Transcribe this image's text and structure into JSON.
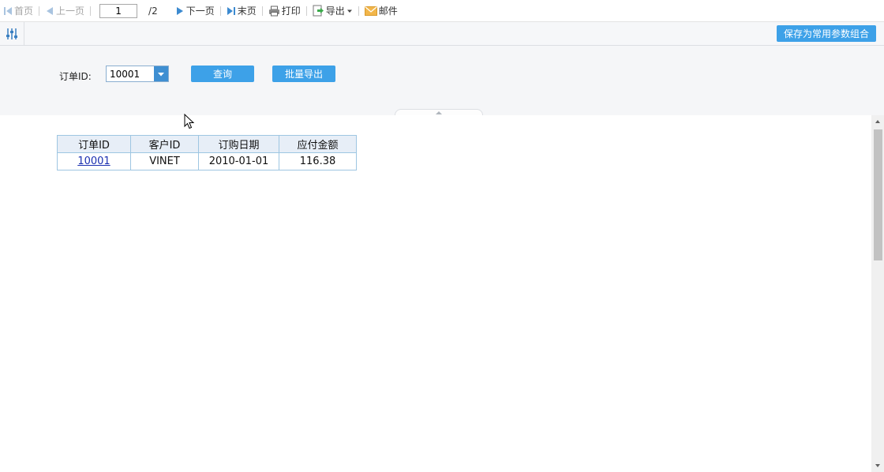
{
  "toolbar": {
    "first": "首页",
    "prev": "上一页",
    "page_current": "1",
    "page_total": "/2",
    "next": "下一页",
    "last": "末页",
    "print": "打印",
    "export": "导出",
    "mail": "邮件"
  },
  "params_bar": {
    "save_label": "保存为常用参数组合"
  },
  "params": {
    "order_id_label": "订单ID:",
    "order_id_value": "10001",
    "query_label": "查询",
    "batch_export_label": "批量导出"
  },
  "report": {
    "columns": [
      "订单ID",
      "客户ID",
      "订购日期",
      "应付金额"
    ],
    "rows": [
      [
        "10001",
        "VINET",
        "2010-01-01",
        "116.38"
      ]
    ]
  },
  "colors": {
    "accent": "#3da1e8",
    "link": "#1a2fb0",
    "header_bg": "#e7eef7",
    "border": "#9ec6e2"
  },
  "icons": [
    "first-page-icon",
    "prev-page-icon",
    "next-page-icon",
    "last-page-icon",
    "print-icon",
    "export-icon",
    "mail-icon",
    "params-toggle-icon",
    "dropdown-arrow-icon"
  ]
}
